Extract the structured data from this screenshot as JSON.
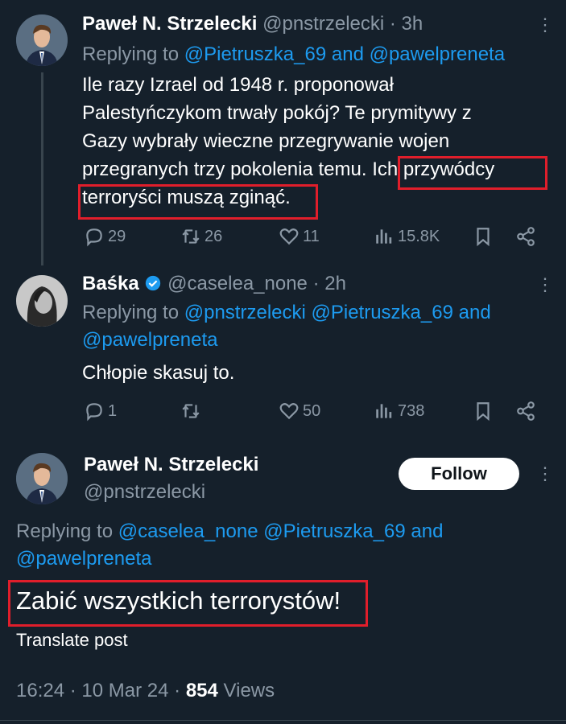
{
  "tweet1": {
    "name": "Paweł N. Strzelecki",
    "handle": "@pnstrzelecki",
    "time": "· 3h",
    "reply_prefix": "Replying to ",
    "reply_user1": "@Pietruszka_69",
    "reply_and": " and ",
    "reply_user2": "@pawelpreneta",
    "text_l1": "Ile razy Izrael od 1948 r. proponował",
    "text_l2": "Palestyńczykom trwały pokój? Te prymitywy z",
    "text_l3": "Gazy wybrały wieczne przegrywanie wojen",
    "text_l4": "przegranych trzy pokolenia temu.",
    "text_l4_hl": "Ich przywódcy",
    "text_l5_hl": "terroryści muszą zginąć.",
    "replies": "29",
    "reposts": "26",
    "likes": "11",
    "views": "15.8K"
  },
  "tweet2": {
    "name": "Baśka",
    "handle": "@caselea_none",
    "time": "· 2h",
    "reply_prefix": "Replying to ",
    "reply_user1": "@pnstrzelecki",
    "reply_user2": "@Pietruszka_69",
    "reply_and": " and",
    "reply_user3": "@pawelpreneta",
    "text": "Chłopie skasuj to.",
    "replies": "1",
    "likes": "50",
    "views": "738"
  },
  "main": {
    "name": "Paweł N. Strzelecki",
    "handle": "@pnstrzelecki",
    "follow_label": "Follow",
    "reply_prefix": "Replying to ",
    "reply_user1": "@caselea_none",
    "reply_user2": "@Pietruszka_69",
    "reply_and": " and",
    "reply_user3": "@pawelpreneta",
    "text": "Zabić wszystkich terrorystów!",
    "translate": "Translate post",
    "time": "16:24",
    "date": "10 Mar 24",
    "views_count": "854",
    "views_label": "Views"
  },
  "colors": {
    "background": "#15202b",
    "link": "#1d9bf0",
    "muted": "#8b98a5",
    "highlight": "#e01e2b"
  },
  "icons": [
    "reply-icon",
    "repost-icon",
    "like-icon",
    "views-icon",
    "bookmark-icon",
    "share-icon",
    "more-icon",
    "verified-badge-icon"
  ]
}
